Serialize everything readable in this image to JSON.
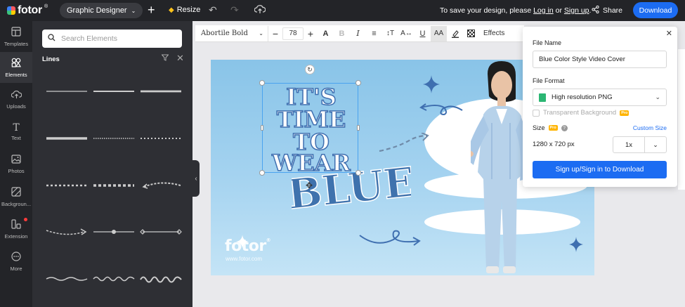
{
  "topbar": {
    "logo_text": "fotor",
    "logo_sup": "®",
    "design_type": "Graphic Designer",
    "resize_label": "Resize",
    "save_note_prefix": "To save your design, please",
    "login_link": "Log in",
    "or_text": "or",
    "signup_link": "Sign up",
    "save_note_suffix": ".",
    "share_label": "Share",
    "download_label": "Download"
  },
  "nav": {
    "items": [
      {
        "label": "Templates",
        "icon": "templates-icon"
      },
      {
        "label": "Elements",
        "icon": "elements-icon"
      },
      {
        "label": "Uploads",
        "icon": "uploads-icon"
      },
      {
        "label": "Text",
        "icon": "text-icon"
      },
      {
        "label": "Photos",
        "icon": "photos-icon"
      },
      {
        "label": "Backgroun...",
        "icon": "background-icon"
      },
      {
        "label": "Extension",
        "icon": "extension-icon"
      },
      {
        "label": "More",
        "icon": "more-icon"
      }
    ],
    "active_index": 1
  },
  "panel": {
    "search_placeholder": "Search Elements",
    "title": "Lines"
  },
  "text_toolbar": {
    "font": "Abortile Bold",
    "size": "78",
    "effects_label": "Effects"
  },
  "canvas": {
    "headline_lines": [
      "IT'S",
      "TIME",
      "TO",
      "WEAR"
    ],
    "accent_word": "BLUE",
    "watermark": "fotor",
    "watermark_sup": "®",
    "watermark_url": "www.fotor.com"
  },
  "download_popup": {
    "file_name_label": "File Name",
    "file_name_value": "Blue Color Style Video Cover",
    "file_format_label": "File Format",
    "file_format_value": "High resolution PNG",
    "transparent_label": "Transparent Background",
    "pro_badge": "Pro",
    "size_label": "Size",
    "size_help": "?",
    "custom_size_label": "Custom Size",
    "size_value": "1280 x 720 px",
    "scale_value": "1x",
    "signin_button": "Sign up/Sign in to Download"
  },
  "colors": {
    "topbar_bg": "#232428",
    "panel_bg": "#2e2f34",
    "accent_blue": "#1c6cf2",
    "canvas_blue": "#89c4e8",
    "headline_blue": "#3f72ad"
  }
}
